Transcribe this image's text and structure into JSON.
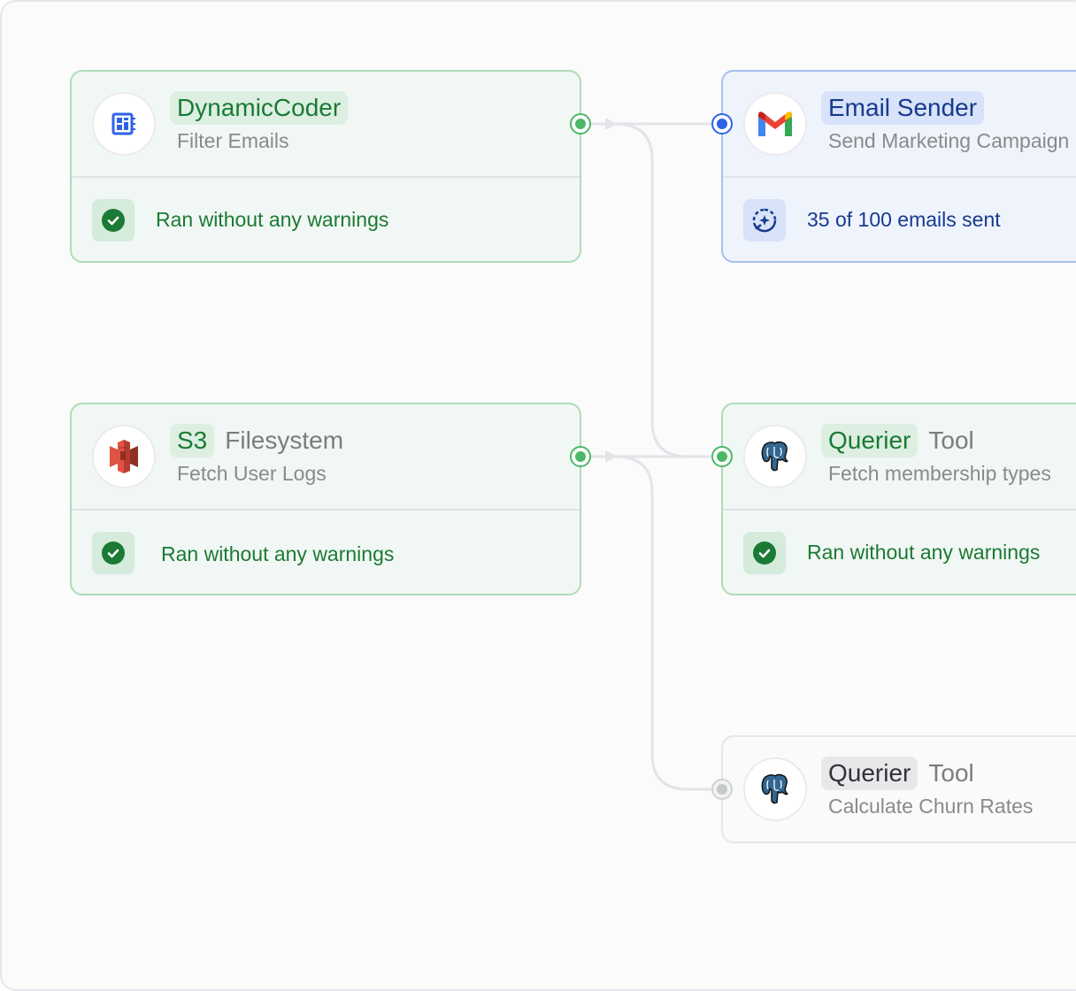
{
  "nodes": {
    "dynamic_coder": {
      "title": "DynamicCoder",
      "suffix": "",
      "subtitle": "Filter Emails",
      "icon": "code-block-icon",
      "status": "success",
      "status_text": "Ran without any warnings"
    },
    "email_sender": {
      "title": "Email Sender",
      "suffix": "",
      "subtitle": "Send Marketing Campaign",
      "icon": "gmail-icon",
      "status": "running",
      "status_text": "35 of 100 emails sent",
      "progress": {
        "done": 35,
        "total": 100
      }
    },
    "s3_filesystem": {
      "title": "S3",
      "suffix": "Filesystem",
      "subtitle": "Fetch User Logs",
      "icon": "aws-s3-icon",
      "status": "success",
      "status_text": "Ran without any warnings"
    },
    "querier_membership": {
      "title": "Querier",
      "suffix": "Tool",
      "subtitle": "Fetch membership types",
      "icon": "postgresql-icon",
      "status": "success",
      "status_text": "Ran without any warnings"
    },
    "querier_churn": {
      "title": "Querier",
      "suffix": "Tool",
      "subtitle": "Calculate Churn Rates",
      "icon": "postgresql-icon",
      "status": "idle"
    }
  },
  "edges": [
    {
      "from": "dynamic_coder",
      "to": "email_sender"
    },
    {
      "from": "dynamic_coder",
      "to": "querier_membership"
    },
    {
      "from": "s3_filesystem",
      "to": "querier_membership"
    },
    {
      "from": "s3_filesystem",
      "to": "querier_churn"
    }
  ],
  "colors": {
    "success": "#1b7a33",
    "running": "#163a8e",
    "port_success": "#4cb866",
    "port_running": "#2f62e6",
    "port_idle": "#c3cac8"
  }
}
